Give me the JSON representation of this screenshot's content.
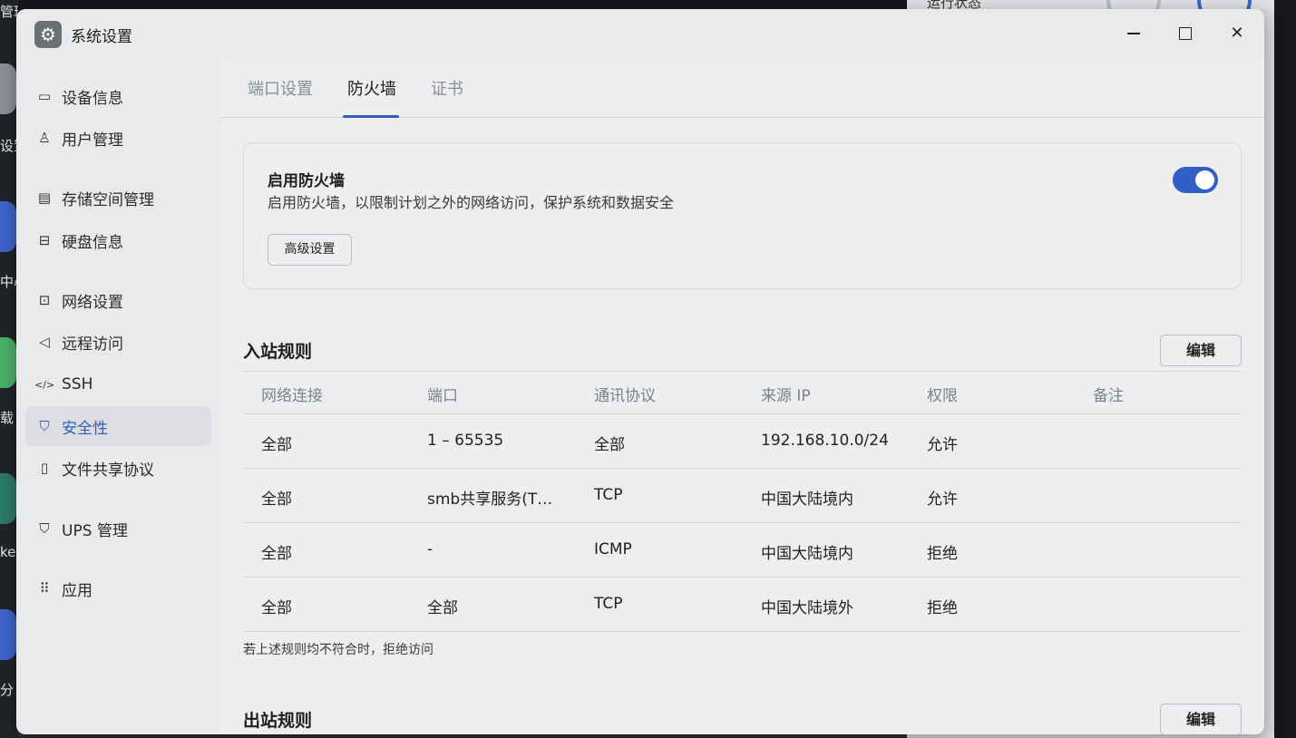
{
  "window": {
    "title": "系统设置",
    "controls": {
      "minimize": "",
      "maximize": "",
      "close": "✕"
    }
  },
  "desktop": {
    "left_labels": [
      "管理",
      "设置",
      "中心",
      "载",
      "ker",
      "分"
    ],
    "right_status": "运行状态"
  },
  "sidebar": {
    "items": [
      {
        "label": "设备信息",
        "icon": "device-icon"
      },
      {
        "label": "用户管理",
        "icon": "user-icon"
      },
      {
        "label": "存储空间管理",
        "icon": "storage-icon"
      },
      {
        "label": "硬盘信息",
        "icon": "disk-icon"
      },
      {
        "label": "网络设置",
        "icon": "network-icon"
      },
      {
        "label": "远程访问",
        "icon": "send-icon"
      },
      {
        "label": "SSH",
        "icon": "code-icon"
      },
      {
        "label": "安全性",
        "icon": "shield-check-icon",
        "active": true
      },
      {
        "label": "文件共享协议",
        "icon": "document-icon"
      },
      {
        "label": "UPS 管理",
        "icon": "shield-icon"
      },
      {
        "label": "应用",
        "icon": "apps-icon"
      }
    ]
  },
  "tabs": [
    {
      "label": "端口设置"
    },
    {
      "label": "防火墙",
      "active": true
    },
    {
      "label": "证书"
    }
  ],
  "firewall": {
    "title": "启用防火墙",
    "description": "启用防火墙，以限制计划之外的网络访问，保护系统和数据安全",
    "advanced_button": "高级设置",
    "enabled": true
  },
  "inbound": {
    "title": "入站规则",
    "edit_button": "编辑",
    "columns": [
      "网络连接",
      "端口",
      "通讯协议",
      "来源 IP",
      "权限",
      "备注"
    ],
    "rows": [
      [
        "全部",
        "1 – 65535",
        "全部",
        "192.168.10.0/24",
        "允许",
        ""
      ],
      [
        "全部",
        "smb共享服务(T…",
        "TCP",
        "中国大陆境内",
        "允许",
        ""
      ],
      [
        "全部",
        "-",
        "ICMP",
        "中国大陆境内",
        "拒绝",
        ""
      ],
      [
        "全部",
        "全部",
        "TCP",
        "中国大陆境外",
        "拒绝",
        ""
      ]
    ],
    "note": "若上述规则均不符合时，拒绝访问"
  },
  "outbound": {
    "title": "出站规则",
    "edit_button": "编辑"
  },
  "colors": {
    "accent": "#2f5fc7"
  }
}
